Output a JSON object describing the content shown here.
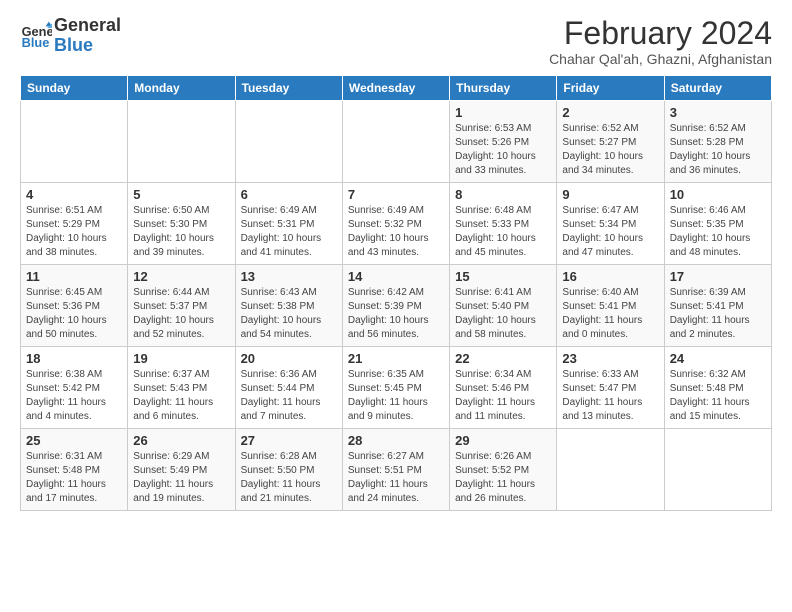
{
  "logo": {
    "general": "General",
    "blue": "Blue"
  },
  "title": "February 2024",
  "subtitle": "Chahar Qal'ah, Ghazni, Afghanistan",
  "days_of_week": [
    "Sunday",
    "Monday",
    "Tuesday",
    "Wednesday",
    "Thursday",
    "Friday",
    "Saturday"
  ],
  "weeks": [
    [
      {
        "day": "",
        "info": ""
      },
      {
        "day": "",
        "info": ""
      },
      {
        "day": "",
        "info": ""
      },
      {
        "day": "",
        "info": ""
      },
      {
        "day": "1",
        "info": "Sunrise: 6:53 AM\nSunset: 5:26 PM\nDaylight: 10 hours and 33 minutes."
      },
      {
        "day": "2",
        "info": "Sunrise: 6:52 AM\nSunset: 5:27 PM\nDaylight: 10 hours and 34 minutes."
      },
      {
        "day": "3",
        "info": "Sunrise: 6:52 AM\nSunset: 5:28 PM\nDaylight: 10 hours and 36 minutes."
      }
    ],
    [
      {
        "day": "4",
        "info": "Sunrise: 6:51 AM\nSunset: 5:29 PM\nDaylight: 10 hours and 38 minutes."
      },
      {
        "day": "5",
        "info": "Sunrise: 6:50 AM\nSunset: 5:30 PM\nDaylight: 10 hours and 39 minutes."
      },
      {
        "day": "6",
        "info": "Sunrise: 6:49 AM\nSunset: 5:31 PM\nDaylight: 10 hours and 41 minutes."
      },
      {
        "day": "7",
        "info": "Sunrise: 6:49 AM\nSunset: 5:32 PM\nDaylight: 10 hours and 43 minutes."
      },
      {
        "day": "8",
        "info": "Sunrise: 6:48 AM\nSunset: 5:33 PM\nDaylight: 10 hours and 45 minutes."
      },
      {
        "day": "9",
        "info": "Sunrise: 6:47 AM\nSunset: 5:34 PM\nDaylight: 10 hours and 47 minutes."
      },
      {
        "day": "10",
        "info": "Sunrise: 6:46 AM\nSunset: 5:35 PM\nDaylight: 10 hours and 48 minutes."
      }
    ],
    [
      {
        "day": "11",
        "info": "Sunrise: 6:45 AM\nSunset: 5:36 PM\nDaylight: 10 hours and 50 minutes."
      },
      {
        "day": "12",
        "info": "Sunrise: 6:44 AM\nSunset: 5:37 PM\nDaylight: 10 hours and 52 minutes."
      },
      {
        "day": "13",
        "info": "Sunrise: 6:43 AM\nSunset: 5:38 PM\nDaylight: 10 hours and 54 minutes."
      },
      {
        "day": "14",
        "info": "Sunrise: 6:42 AM\nSunset: 5:39 PM\nDaylight: 10 hours and 56 minutes."
      },
      {
        "day": "15",
        "info": "Sunrise: 6:41 AM\nSunset: 5:40 PM\nDaylight: 10 hours and 58 minutes."
      },
      {
        "day": "16",
        "info": "Sunrise: 6:40 AM\nSunset: 5:41 PM\nDaylight: 11 hours and 0 minutes."
      },
      {
        "day": "17",
        "info": "Sunrise: 6:39 AM\nSunset: 5:41 PM\nDaylight: 11 hours and 2 minutes."
      }
    ],
    [
      {
        "day": "18",
        "info": "Sunrise: 6:38 AM\nSunset: 5:42 PM\nDaylight: 11 hours and 4 minutes."
      },
      {
        "day": "19",
        "info": "Sunrise: 6:37 AM\nSunset: 5:43 PM\nDaylight: 11 hours and 6 minutes."
      },
      {
        "day": "20",
        "info": "Sunrise: 6:36 AM\nSunset: 5:44 PM\nDaylight: 11 hours and 7 minutes."
      },
      {
        "day": "21",
        "info": "Sunrise: 6:35 AM\nSunset: 5:45 PM\nDaylight: 11 hours and 9 minutes."
      },
      {
        "day": "22",
        "info": "Sunrise: 6:34 AM\nSunset: 5:46 PM\nDaylight: 11 hours and 11 minutes."
      },
      {
        "day": "23",
        "info": "Sunrise: 6:33 AM\nSunset: 5:47 PM\nDaylight: 11 hours and 13 minutes."
      },
      {
        "day": "24",
        "info": "Sunrise: 6:32 AM\nSunset: 5:48 PM\nDaylight: 11 hours and 15 minutes."
      }
    ],
    [
      {
        "day": "25",
        "info": "Sunrise: 6:31 AM\nSunset: 5:48 PM\nDaylight: 11 hours and 17 minutes."
      },
      {
        "day": "26",
        "info": "Sunrise: 6:29 AM\nSunset: 5:49 PM\nDaylight: 11 hours and 19 minutes."
      },
      {
        "day": "27",
        "info": "Sunrise: 6:28 AM\nSunset: 5:50 PM\nDaylight: 11 hours and 21 minutes."
      },
      {
        "day": "28",
        "info": "Sunrise: 6:27 AM\nSunset: 5:51 PM\nDaylight: 11 hours and 24 minutes."
      },
      {
        "day": "29",
        "info": "Sunrise: 6:26 AM\nSunset: 5:52 PM\nDaylight: 11 hours and 26 minutes."
      },
      {
        "day": "",
        "info": ""
      },
      {
        "day": "",
        "info": ""
      }
    ]
  ]
}
